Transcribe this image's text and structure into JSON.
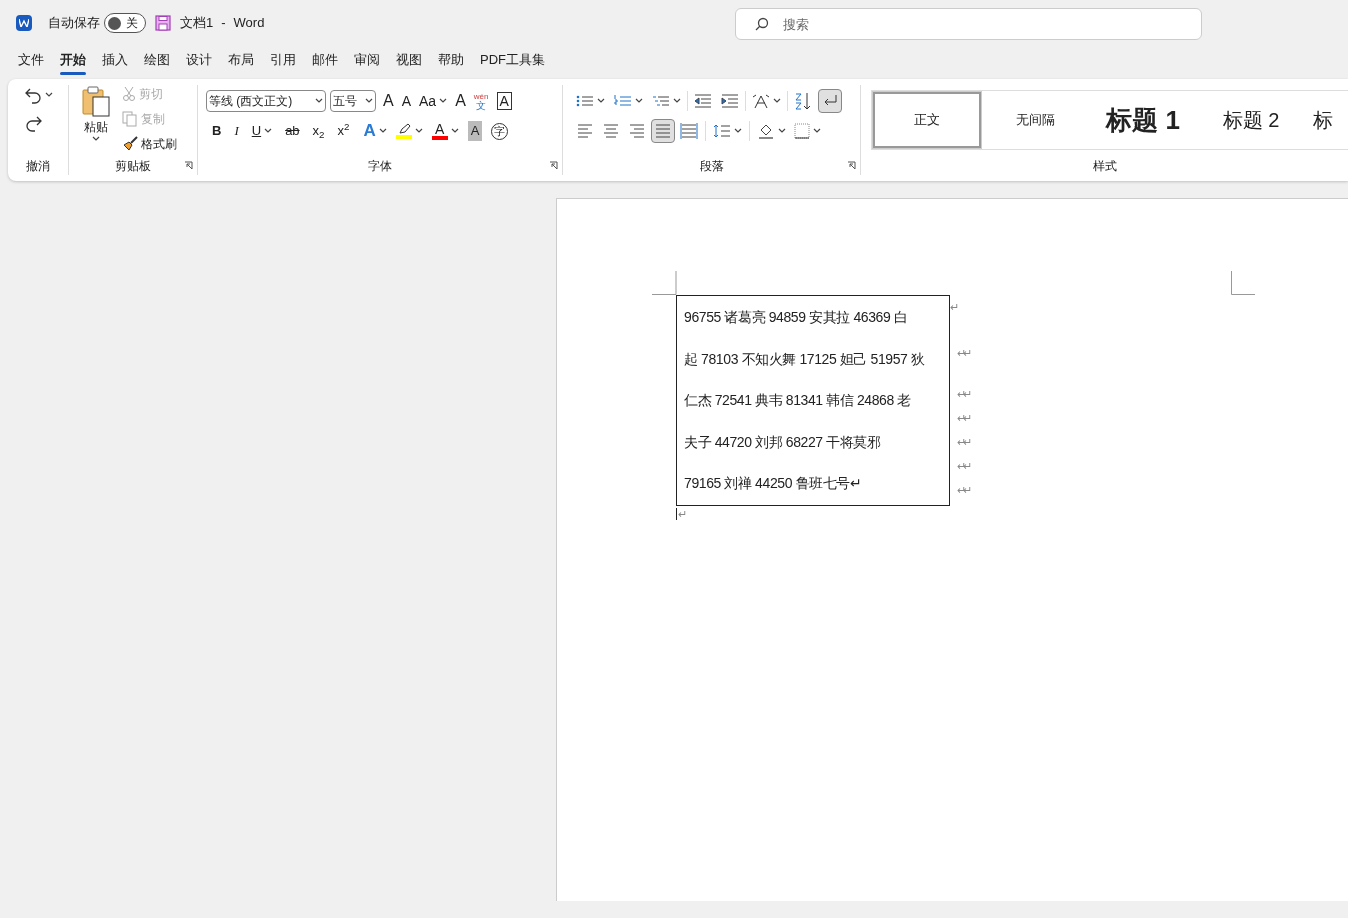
{
  "title_bar": {
    "autosave": {
      "label": "自动保存",
      "on": false,
      "state_text": "关"
    },
    "document_title": "文档1",
    "separator": "-",
    "app_name": "Word",
    "search": {
      "placeholder": "搜索"
    }
  },
  "tabs": [
    {
      "label": "文件",
      "selected": false
    },
    {
      "label": "开始",
      "selected": true
    },
    {
      "label": "插入",
      "selected": false
    },
    {
      "label": "绘图",
      "selected": false
    },
    {
      "label": "设计",
      "selected": false
    },
    {
      "label": "布局",
      "selected": false
    },
    {
      "label": "引用",
      "selected": false
    },
    {
      "label": "邮件",
      "selected": false
    },
    {
      "label": "审阅",
      "selected": false
    },
    {
      "label": "视图",
      "selected": false
    },
    {
      "label": "帮助",
      "selected": false
    },
    {
      "label": "PDF工具集",
      "selected": false
    }
  ],
  "ribbon": {
    "undo_group": {
      "label": "撤消"
    },
    "clipboard_group": {
      "label": "剪贴板",
      "paste": "粘贴",
      "cut": {
        "label": "剪切",
        "disabled": true
      },
      "copy": {
        "label": "复制",
        "disabled": true
      },
      "format_painter": {
        "label": "格式刷",
        "disabled": false
      }
    },
    "font_group": {
      "label": "字体",
      "font_name": "等线 (西文正文)",
      "font_size": "五号",
      "top_glyphs": [
        {
          "kind": "grow",
          "label": "A"
        },
        {
          "kind": "shrink",
          "label": "A"
        },
        {
          "kind": "case",
          "label": "Aa"
        },
        {
          "kind": "clear",
          "label": "A"
        },
        {
          "kind": "phonetic",
          "label": "wén",
          "sub": "文"
        },
        {
          "kind": "border",
          "label": "A"
        }
      ],
      "format_buttons": [
        {
          "kind": "bold",
          "label": "B"
        },
        {
          "kind": "italic",
          "label": "I"
        },
        {
          "kind": "underline",
          "label": "U"
        },
        {
          "kind": "strike",
          "label": "ab"
        },
        {
          "kind": "sub",
          "label": "x$_{2}$"
        },
        {
          "kind": "sup",
          "label": "x$^{2}$"
        }
      ],
      "color_buttons": [
        {
          "kind": "effect",
          "label": "A"
        },
        {
          "kind": "highlight",
          "color": "#ffff00"
        },
        {
          "kind": "font_color",
          "label": "A",
          "color": "#ff0000"
        },
        {
          "kind": "shading",
          "label": "A"
        },
        {
          "kind": "enclose",
          "label": "字"
        }
      ]
    },
    "paragraph_group": {
      "label": "段落",
      "show_marks": {
        "selected": true
      },
      "alignment": [
        {
          "kind": "left",
          "selected": false
        },
        {
          "kind": "center",
          "selected": false
        },
        {
          "kind": "right",
          "selected": false
        },
        {
          "kind": "justify",
          "selected": true
        },
        {
          "kind": "distributed",
          "selected": false
        }
      ]
    },
    "styles_group": {
      "label": "样式",
      "styles": [
        {
          "label": "正文",
          "kind": "normal",
          "selected": true
        },
        {
          "label": "无间隔",
          "kind": "normal",
          "selected": false
        },
        {
          "label": "标题 1",
          "kind": "heading1",
          "selected": false
        },
        {
          "label": "标题 2",
          "kind": "heading2",
          "selected": false
        },
        {
          "label": "标",
          "kind": "heading2",
          "selected": false
        }
      ]
    }
  },
  "document": {
    "text_box_lines": [
      "96755 诸葛亮 94859 安其拉 46369 白",
      "起 78103 不知火舞 17125 妲己 51957 狄",
      "仁杰 72541 典韦 81341 韩信 24868 老",
      "夫子 44720 刘邦 68227 干将莫邪",
      "79165 刘禅 44250 鲁班七号↵"
    ],
    "side_marks": [
      "↵",
      "↵↵",
      "↵↵",
      "↵↵",
      "↵↵",
      "↵↵",
      "↵↵"
    ],
    "after_box_mark": "↵"
  }
}
